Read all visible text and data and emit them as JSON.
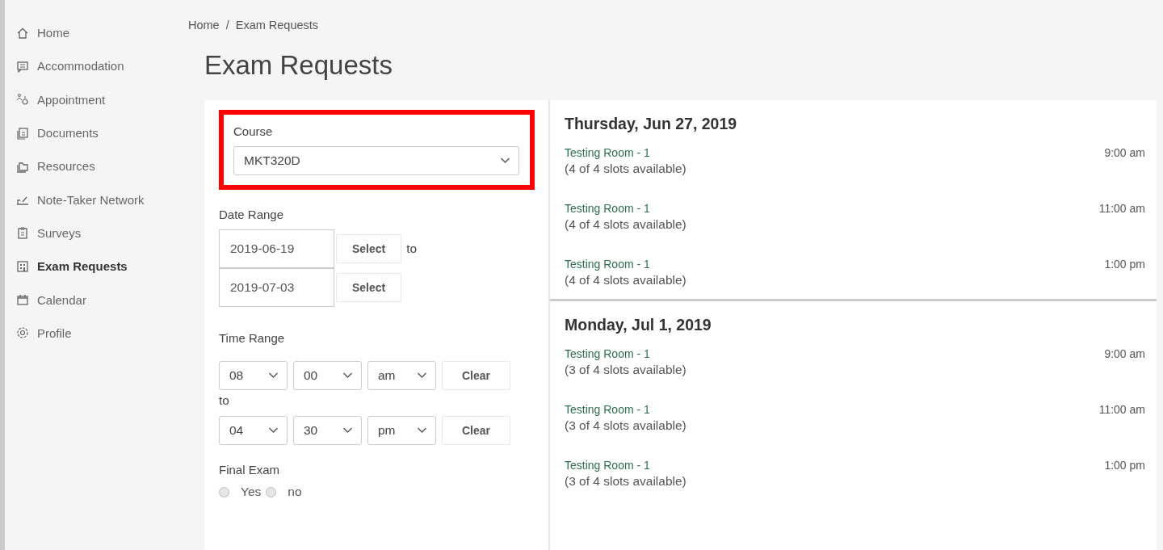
{
  "sidebar": {
    "items": [
      {
        "label": "Home",
        "selected": false
      },
      {
        "label": "Accommodation",
        "selected": false
      },
      {
        "label": "Appointment",
        "selected": false
      },
      {
        "label": "Documents",
        "selected": false
      },
      {
        "label": "Resources",
        "selected": false
      },
      {
        "label": "Note-Taker Network",
        "selected": false
      },
      {
        "label": "Surveys",
        "selected": false
      },
      {
        "label": "Exam Requests",
        "selected": true
      },
      {
        "label": "Calendar",
        "selected": false
      },
      {
        "label": "Profile",
        "selected": false
      }
    ]
  },
  "breadcrumb": [
    "Home",
    "Exam Requests"
  ],
  "breadcrumb_separator": "/",
  "title": "Exam Requests",
  "form": {
    "course": {
      "label": "Course",
      "value": "MKT320D",
      "highlighted": true
    },
    "date_range": {
      "label": "Date Range",
      "joiner": "to",
      "from": {
        "value": "2019-06-19",
        "button": "Select"
      },
      "to": {
        "value": "2019-07-03",
        "button": "Select"
      }
    },
    "time_range": {
      "label": "Time Range",
      "joiner": "to",
      "from": {
        "hour": "08",
        "minute": "00",
        "period": "am",
        "clear": "Clear"
      },
      "to": {
        "hour": "04",
        "minute": "30",
        "period": "pm",
        "clear": "Clear"
      }
    },
    "final_exam": {
      "label": "Final Exam",
      "options": [
        {
          "label": "Yes",
          "selected": false
        },
        {
          "label": "no",
          "selected": false
        }
      ]
    }
  },
  "days": [
    {
      "heading": "Thursday, Jun 27, 2019",
      "slots": [
        {
          "room": "Testing Room - 1",
          "availability": "(4 of 4 slots available)",
          "time": "9:00 am"
        },
        {
          "room": "Testing Room - 1",
          "availability": "(4 of 4 slots available)",
          "time": "11:00 am"
        },
        {
          "room": "Testing Room - 1",
          "availability": "(4 of 4 slots available)",
          "time": "1:00 pm"
        }
      ]
    },
    {
      "heading": "Monday, Jul 1, 2019",
      "slots": [
        {
          "room": "Testing Room - 1",
          "availability": "(3 of 4 slots available)",
          "time": "9:00 am"
        },
        {
          "room": "Testing Room - 1",
          "availability": "(3 of 4 slots available)",
          "time": "11:00 am"
        },
        {
          "room": "Testing Room - 1",
          "availability": "(3 of 4 slots available)",
          "time": "1:00 pm"
        }
      ]
    }
  ]
}
